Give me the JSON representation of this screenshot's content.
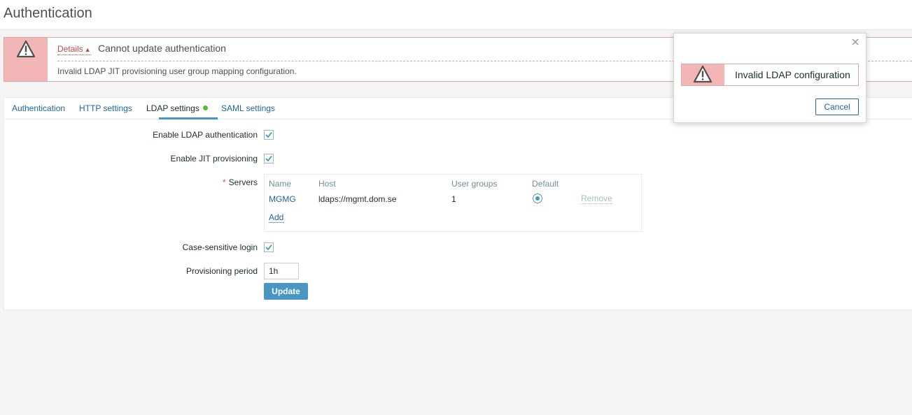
{
  "page": {
    "title": "Authentication"
  },
  "message": {
    "details_label": "Details",
    "arrow": "▲",
    "title": "Cannot update authentication",
    "detail": "Invalid LDAP JIT provisioning user group mapping configuration.",
    "color_bg": "#f3b6b6"
  },
  "tabs": [
    {
      "label": "Authentication"
    },
    {
      "label": "HTTP settings"
    },
    {
      "label": "LDAP settings"
    },
    {
      "label": "SAML settings"
    }
  ],
  "form": {
    "enable_ldap_label": "Enable LDAP authentication",
    "enable_jit_label": "Enable JIT provisioning",
    "servers_required": "*",
    "servers_label": "Servers",
    "case_sensitive_label": "Case-sensitive login",
    "provisioning_period_label": "Provisioning period",
    "provisioning_period_value": "1h",
    "update_button": "Update"
  },
  "servers": {
    "headers": {
      "name": "Name",
      "host": "Host",
      "user_groups": "User groups",
      "default": "Default"
    },
    "rows": [
      {
        "name": "MGMG",
        "host": "ldaps://mgmt.dom.se",
        "user_groups": "1",
        "remove": "Remove"
      }
    ],
    "add_label": "Add"
  },
  "dialog": {
    "message": "Invalid LDAP configuration",
    "cancel_button": "Cancel"
  },
  "icons": {
    "warning": "warning-triangle-icon",
    "close": "close-icon",
    "check": "check-icon"
  }
}
